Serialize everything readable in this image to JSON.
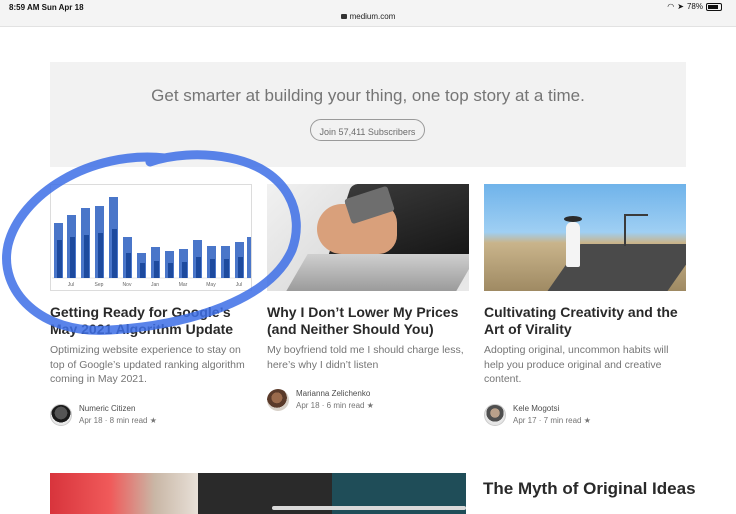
{
  "status_bar": {
    "time": "8:59 AM  Sun Apr 18",
    "url": "medium.com",
    "battery": "78%"
  },
  "banner": {
    "headline": "Get smarter at building your thing, one top story at a time.",
    "subscribe_label": "Join 57,411 Subscribers"
  },
  "articles": [
    {
      "title": "Getting Ready for Google’s May 2021 Algorithm Update",
      "excerpt": "Optimizing website experience to stay on top of Google’s updated ranking algorithm coming in May 2021.",
      "author": "Numeric Citizen",
      "meta": "Apr 18 · 8 min read",
      "chart_months": [
        "Jul",
        "Sep",
        "Nov",
        "Jan",
        "Mar",
        "May",
        "Jul"
      ]
    },
    {
      "title": "Why I Don’t Lower My Prices (and Neither Should You)",
      "excerpt": "My boyfriend told me I should charge less, here’s why I didn’t listen",
      "author": "Marianna Zelichenko",
      "meta": "Apr 18 · 6 min read"
    },
    {
      "title": "Cultivating Creativity and the Art of Virality",
      "excerpt": "Adopting original, uncommon habits will help you produce original and creative content.",
      "author": "Kele Mogotsi",
      "meta": "Apr 17 · 7 min read"
    }
  ],
  "bottom_article": {
    "title": "The Myth of Original Ideas"
  },
  "colors": {
    "chart_light": "#4a76c9",
    "chart_dark": "#1d4a9e",
    "scribble": "#3d6fe6"
  },
  "icons": [
    "lock-icon",
    "wifi-icon",
    "location-icon",
    "battery-icon",
    "star-icon"
  ]
}
